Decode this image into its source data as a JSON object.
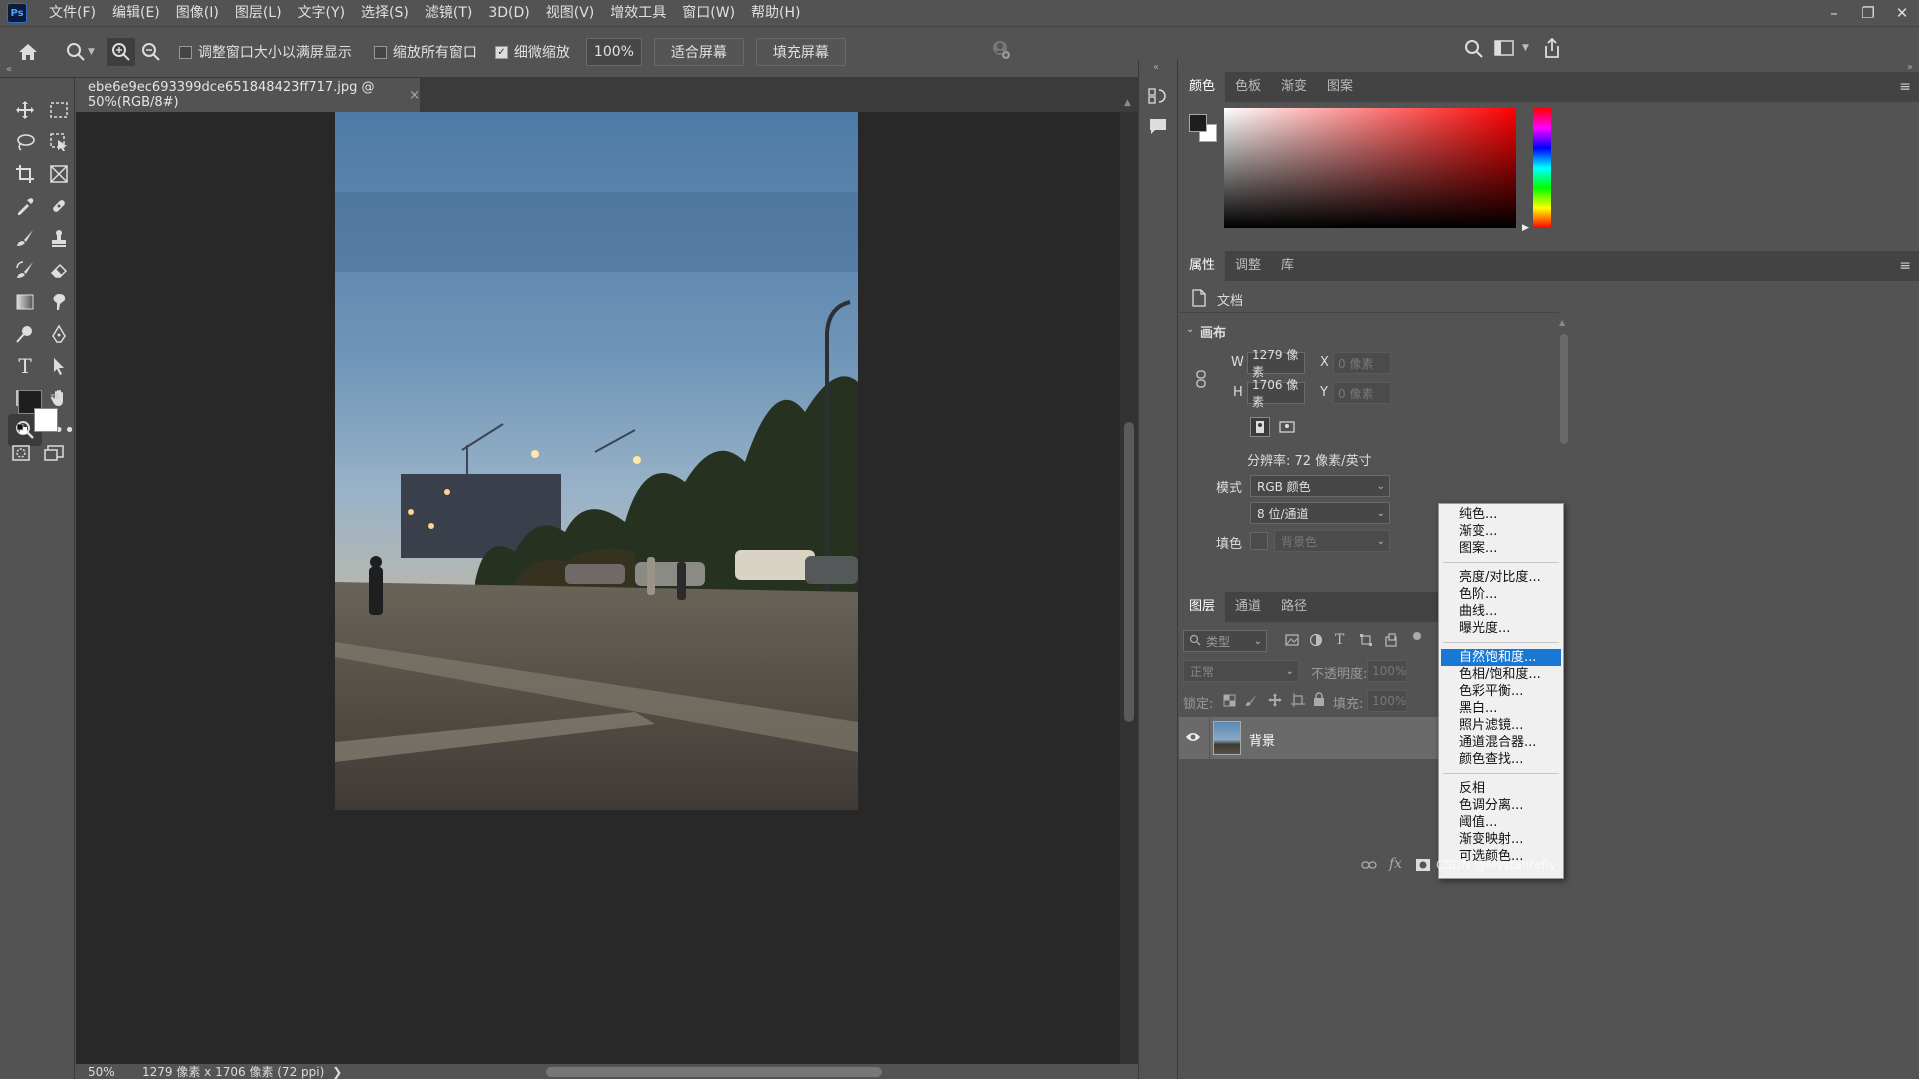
{
  "app": {
    "logo": "Ps"
  },
  "menubar": {
    "items": [
      "文件(F)",
      "编辑(E)",
      "图像(I)",
      "图层(L)",
      "文字(Y)",
      "选择(S)",
      "滤镜(T)",
      "3D(D)",
      "视图(V)",
      "增效工具",
      "窗口(W)",
      "帮助(H)"
    ]
  },
  "window_controls": {
    "minimize": "–",
    "restore": "❐",
    "close": "✕"
  },
  "options": {
    "resize_windows_label": "调整窗口大小以满屏显示",
    "zoom_all_label": "缩放所有窗口",
    "scrubby_zoom_label": "细微缩放",
    "zoom_value": "100%",
    "fit_screen": "适合屏幕",
    "fill_screen": "填充屏幕"
  },
  "document": {
    "tab_title": "ebe6e9ec693399dce651848423ff717.jpg @ 50%(RGB/8#)",
    "close": "×"
  },
  "status": {
    "zoom": "50%",
    "info": "1279 像素 x 1706 像素 (72 ppi)",
    "arrow": "❯"
  },
  "color_panel": {
    "tabs": [
      "颜色",
      "色板",
      "渐变",
      "图案"
    ]
  },
  "properties_panel": {
    "tabs": [
      "属性",
      "调整",
      "库"
    ],
    "doc_label": "文档",
    "canvas_section": "画布",
    "w_label": "W",
    "w_value": "1279 像素",
    "h_label": "H",
    "h_value": "1706 像素",
    "x_label": "X",
    "x_placeholder": "0 像素",
    "y_label": "Y",
    "y_placeholder": "0 像素",
    "resolution": "分辨率: 72 像素/英寸",
    "mode_label": "模式",
    "mode_value": "RGB 颜色",
    "depth_value": "8 位/通道",
    "fill_label": "填色",
    "fill_value": "背景色"
  },
  "layers_panel": {
    "tabs": [
      "图层",
      "通道",
      "路径"
    ],
    "filter_placeholder": "类型",
    "blend_mode": "正常",
    "opacity_label": "不透明度:",
    "opacity_value": "100%",
    "lock_label": "锁定:",
    "fill_label": "填充:",
    "fill_value": "100%",
    "layer_name": "背景"
  },
  "context_menu": {
    "group1": [
      "纯色...",
      "渐变...",
      "图案..."
    ],
    "group2": [
      "亮度/对比度...",
      "色阶...",
      "曲线...",
      "曝光度..."
    ],
    "group3": [
      "自然饱和度...",
      "色相/饱和度...",
      "色彩平衡...",
      "黑白...",
      "照片滤镜...",
      "通道混合器...",
      "颜色查找..."
    ],
    "group4": [
      "反相",
      "色调分离...",
      "阈值...",
      "渐变映射...",
      "可选颜色..."
    ],
    "highlighted": "自然饱和度..."
  },
  "watermark": "CSDN @Mystantefly"
}
